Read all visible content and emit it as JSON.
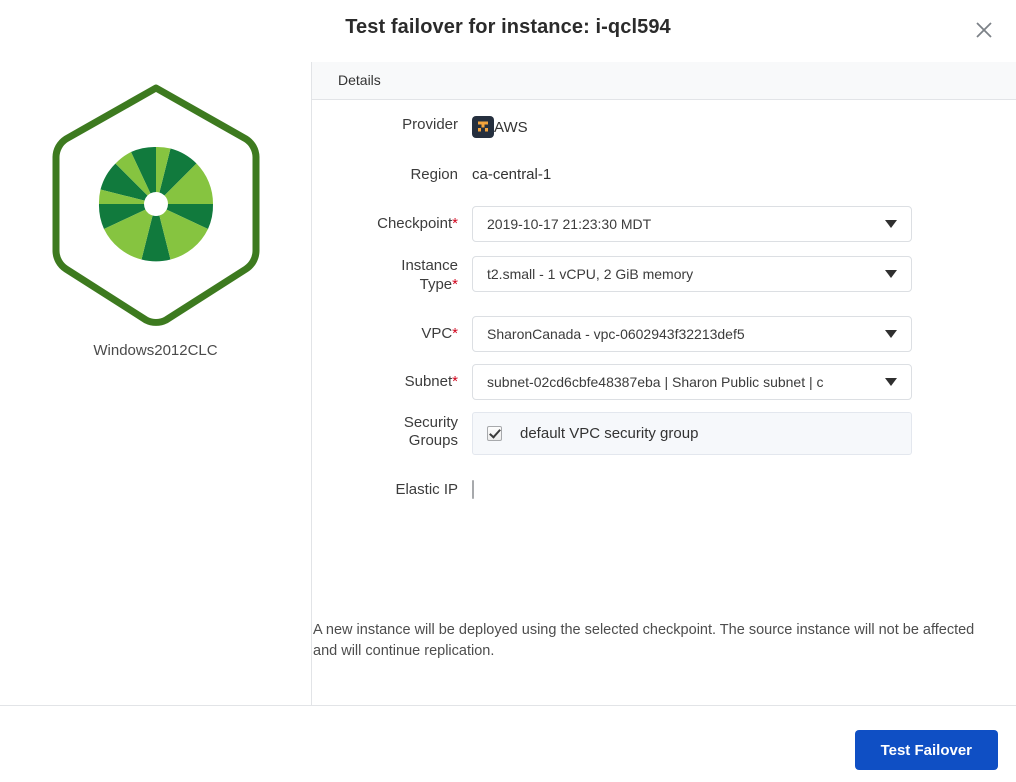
{
  "dialog": {
    "title": "Test failover for instance: i-qcl594",
    "close_icon": "close-icon"
  },
  "left_pane": {
    "logo_icon": "hexagon-pinwheel-logo",
    "instance_name": "Windows2012CLC"
  },
  "tabs": [
    {
      "label": "Details",
      "active": true
    }
  ],
  "form": {
    "provider": {
      "label": "Provider",
      "value": "AWS",
      "icon": "aws-icon"
    },
    "region": {
      "label": "Region",
      "value": "ca-central-1"
    },
    "checkpoint": {
      "label": "Checkpoint",
      "required": true,
      "value": "2019-10-17 21:23:30 MDT"
    },
    "instance_type": {
      "label_line1": "Instance",
      "label_line2": "Type",
      "required": true,
      "value": "t2.small - 1 vCPU, 2 GiB memory"
    },
    "vpc": {
      "label": "VPC",
      "required": true,
      "value": "SharonCanada - vpc-0602943f32213def5"
    },
    "subnet": {
      "label": "Subnet",
      "required": true,
      "value": "subnet-02cd6cbfe48387eba | Sharon Public subnet | c"
    },
    "security_groups": {
      "label_line1": "Security",
      "label_line2": "Groups",
      "items": [
        {
          "label": "default VPC security group",
          "checked": true
        }
      ]
    },
    "elastic_ip": {
      "label": "Elastic IP",
      "checked": false
    }
  },
  "note": "A new instance will be deployed using the selected checkpoint. The source instance will not be affected and will continue replication.",
  "footer": {
    "primary_button": "Test Failover"
  },
  "colors": {
    "primary_button": "#0f4fc4",
    "required_asterisk": "#d0021b",
    "logo_dark_green": "#117a3d",
    "logo_light_green": "#86c440",
    "logo_outline": "#3d7a1f",
    "aws_badge_bg": "#252f3e",
    "aws_glyph": "#f2a33c"
  }
}
